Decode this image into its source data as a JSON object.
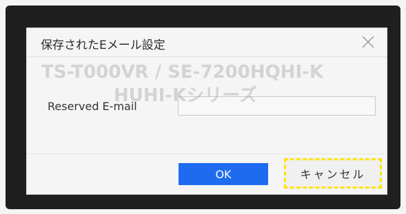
{
  "dialog": {
    "title": "保存されたEメール設定",
    "close_icon": "close-icon",
    "field_label": "Reserved E-mail",
    "email_value": "",
    "ok_label": "OK",
    "cancel_label": "キャンセル"
  },
  "watermark": {
    "line1": "TS-T000VR / SE-7200HQHI-K",
    "line2": "HUHI-Kシリーズ"
  },
  "colors": {
    "primary_button": "#1e6bf0",
    "focus_highlight": "#ffe600",
    "screen_bezel": "#1f1f1f"
  }
}
